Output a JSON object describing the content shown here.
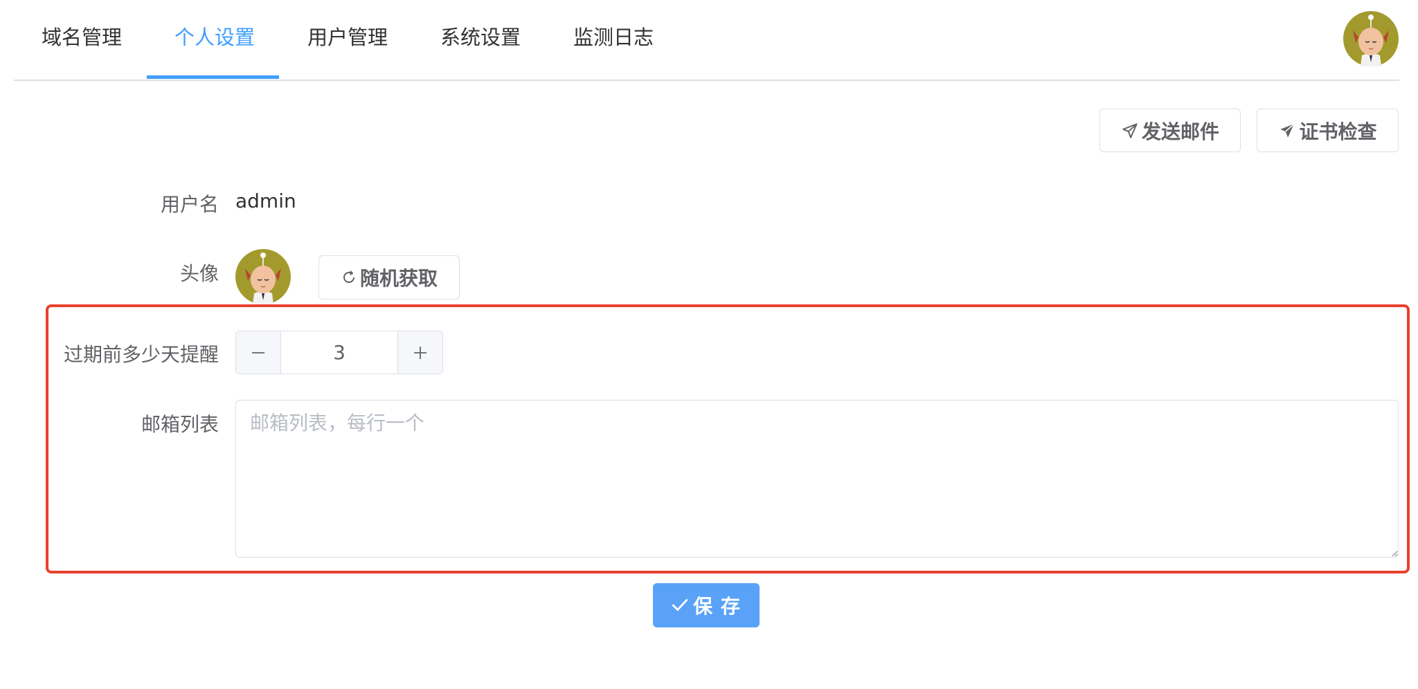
{
  "nav": {
    "tabs": [
      {
        "label": "域名管理"
      },
      {
        "label": "个人设置"
      },
      {
        "label": "用户管理"
      },
      {
        "label": "系统设置"
      },
      {
        "label": "监测日志"
      }
    ],
    "active_tab": "个人设置",
    "user_avatar_icon": "avatar-icon"
  },
  "toolbar": {
    "send_mail_label": "发送邮件",
    "send_mail_icon": "paper-plane-outline-icon",
    "cert_check_label": "证书检查",
    "cert_check_icon": "paper-plane-filled-icon"
  },
  "form": {
    "username_label": "用户名",
    "username_value": "admin",
    "avatar_label": "头像",
    "random_button_label": "随机获取",
    "random_button_icon": "refresh-icon",
    "reminder_label": "过期前多少天提醒",
    "reminder_value": "3",
    "emails_label": "邮箱列表",
    "emails_placeholder": "邮箱列表，每行一个",
    "emails_value": "",
    "save_label": "保 存",
    "save_icon": "check-icon"
  },
  "colors": {
    "accent": "#409eff",
    "save_button": "#5aa2f8",
    "highlight_border": "#e8412c",
    "border": "#dcdfe6"
  }
}
